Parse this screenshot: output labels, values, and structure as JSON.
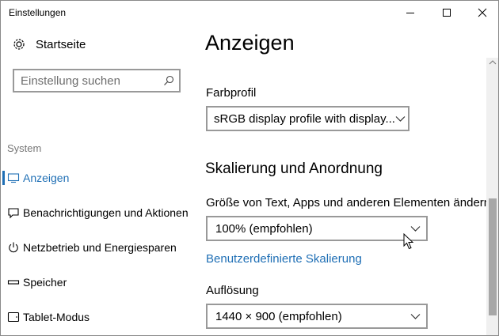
{
  "window": {
    "title": "Einstellungen"
  },
  "sidebar": {
    "home_label": "Startseite",
    "search_placeholder": "Einstellung suchen",
    "section_label": "System",
    "items": [
      {
        "label": "Anzeigen",
        "icon": "monitor-icon",
        "active": true
      },
      {
        "label": "Benachrichtigungen und Aktionen",
        "icon": "notification-icon",
        "active": false
      },
      {
        "label": "Netzbetrieb und Energiesparen",
        "icon": "power-icon",
        "active": false
      },
      {
        "label": "Speicher",
        "icon": "storage-icon",
        "active": false
      },
      {
        "label": "Tablet-Modus",
        "icon": "tablet-icon",
        "active": false
      }
    ]
  },
  "main": {
    "title": "Anzeigen",
    "color_profile_label": "Farbprofil",
    "color_profile_value": "sRGB display profile with display...",
    "scaling_heading": "Skalierung und Anordnung",
    "size_label": "Größe von Text, Apps und anderen Elementen ändern",
    "size_value": "100% (empfohlen)",
    "custom_scaling_link": "Benutzerdefinierte Skalierung",
    "resolution_label": "Auflösung",
    "resolution_value": "1440 × 900 (empfohlen)"
  },
  "colors": {
    "accent": "#1f6fb5",
    "border": "#999999",
    "secondary_text": "#767676"
  }
}
